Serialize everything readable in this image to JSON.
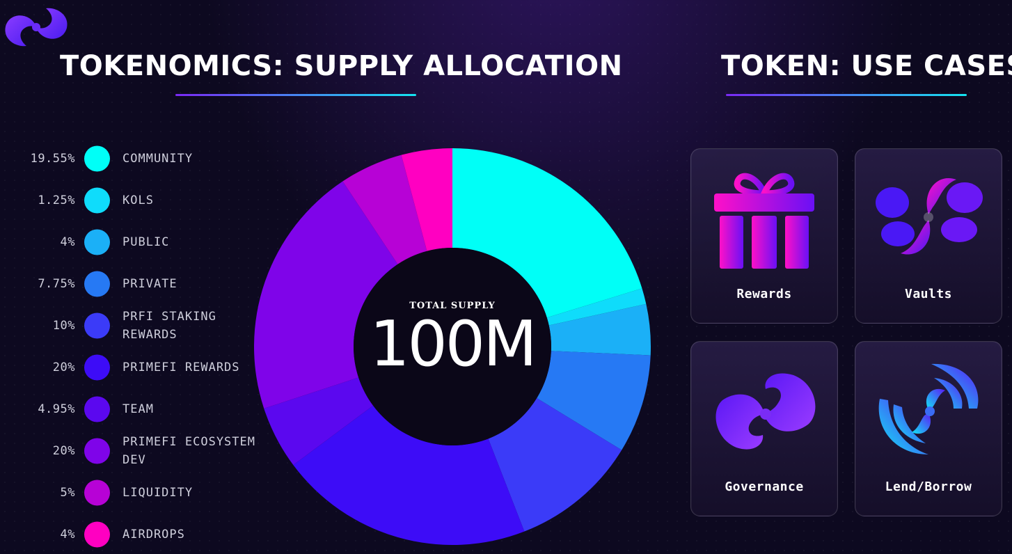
{
  "header": {
    "logo": "primefi-swirl-logo",
    "left_title": "TOKENOMICS: SUPPLY ALLOCATION",
    "right_title": "TOKEN: USE CASES"
  },
  "chart_data": {
    "type": "pie",
    "donut": true,
    "center_label": "TOTAL SUPPLY",
    "center_value": "100M",
    "legend_position": "left",
    "slices": [
      {
        "label": "COMMUNITY",
        "pct_label": "19.55%",
        "value": 19.55,
        "color": "#00fff7"
      },
      {
        "label": "KOLS",
        "pct_label": "1.25%",
        "value": 1.25,
        "color": "#0fdcfb"
      },
      {
        "label": "PUBLIC",
        "pct_label": "4%",
        "value": 4,
        "color": "#1bb0f7"
      },
      {
        "label": "PRIVATE",
        "pct_label": "7.75%",
        "value": 7.75,
        "color": "#2679f4"
      },
      {
        "label": "PRFI STAKING REWARDS",
        "pct_label": "10%",
        "value": 10,
        "color": "#3b3bf8"
      },
      {
        "label": "PRIMEFI REWARDS",
        "pct_label": "20%",
        "value": 20,
        "color": "#3d0cf7"
      },
      {
        "label": "TEAM",
        "pct_label": "4.95%",
        "value": 4.95,
        "color": "#5b08ef"
      },
      {
        "label": "PRIMEFI ECOSYSTEM DEV",
        "pct_label": "20%",
        "value": 20,
        "color": "#7f04e9"
      },
      {
        "label": "LIQUIDITY",
        "pct_label": "5%",
        "value": 5,
        "color": "#b702d6"
      },
      {
        "label": "AIRDROPS",
        "pct_label": "4%",
        "value": 4,
        "color": "#ff00c1"
      }
    ]
  },
  "use_cases": [
    {
      "label": "Rewards",
      "icon": "gift-icon"
    },
    {
      "label": "Vaults",
      "icon": "vault-swirl-icon"
    },
    {
      "label": "Governance",
      "icon": "governance-swirl-icon"
    },
    {
      "label": "Lend/Borrow",
      "icon": "lend-borrow-wave-icon"
    }
  ]
}
